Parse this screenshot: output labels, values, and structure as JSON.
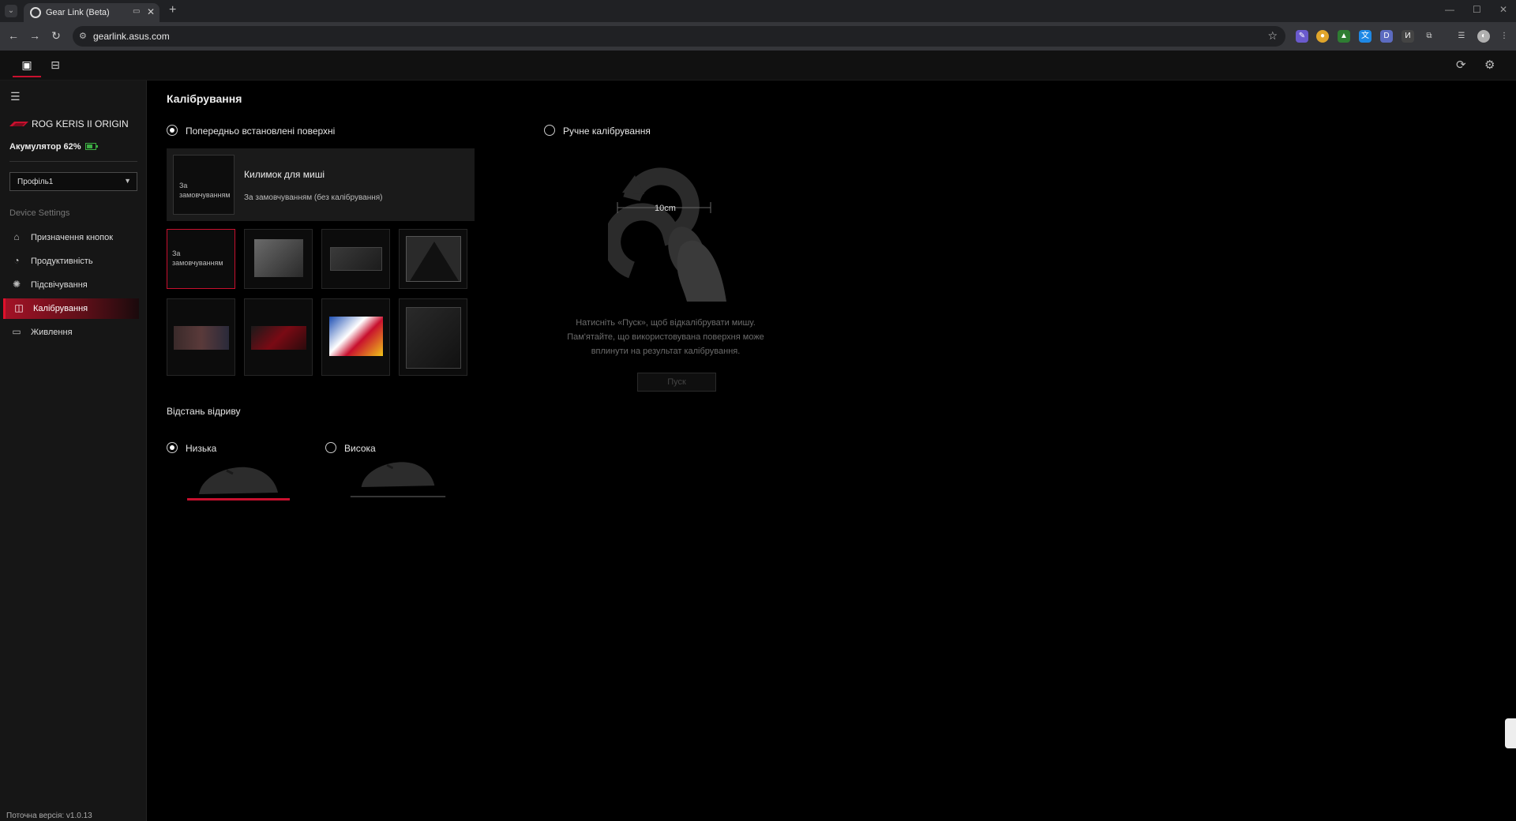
{
  "browser": {
    "tab_title": "Gear Link (Beta)",
    "url": "gearlink.asus.com"
  },
  "sidebar": {
    "device_name": "ROG KERIS II ORIGIN",
    "battery": "Акумулятор 62%",
    "battery_level": 0.62,
    "profile": "Профіль1",
    "section_label": "Device Settings",
    "items": [
      {
        "label": "Призначення кнопок",
        "icon": "mouse-icon",
        "active": false
      },
      {
        "label": "Продуктивність",
        "icon": "gauge-icon",
        "active": false
      },
      {
        "label": "Підсвічування",
        "icon": "light-icon",
        "active": false
      },
      {
        "label": "Калібрування",
        "icon": "calibration-icon",
        "active": true
      },
      {
        "label": "Живлення",
        "icon": "battery-icon",
        "active": false
      }
    ],
    "version": "Поточна версія: v1.0.13"
  },
  "main": {
    "title": "Калібрування",
    "preset_radio": "Попередньо встановлені поверхні",
    "manual_radio": "Ручне калібрування",
    "selected_surface": {
      "thumb_text": "За замовчуванням",
      "name": "Килимок для миші",
      "desc": "За замовчуванням (без калібрування)"
    },
    "default_pad_text": "За замовчуванням",
    "manual": {
      "distance": "10cm",
      "instruction_line1": "Натисніть «Пуск», щоб відкалібрувати мишу.",
      "instruction_line2": "Пам'ятайте, що використовувана поверхня може",
      "instruction_line3": "вплинути на результат калібрування.",
      "start_button": "Пуск"
    },
    "lift_off": {
      "label": "Відстань відриву",
      "low": "Низька",
      "high": "Висока"
    }
  },
  "colors": {
    "accent": "#c8102e",
    "battery": "#3cb043"
  }
}
